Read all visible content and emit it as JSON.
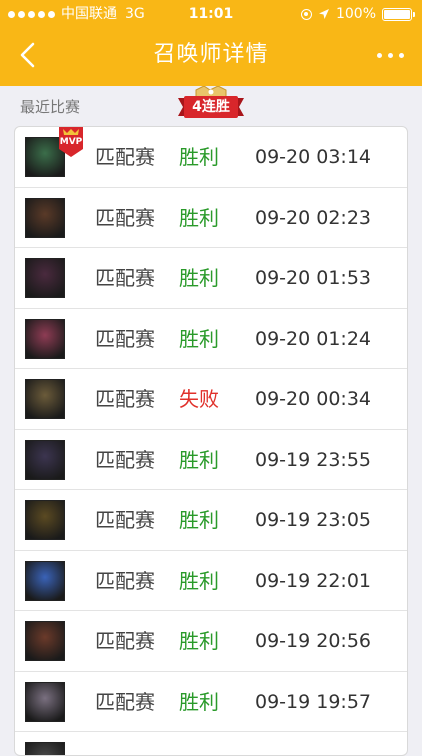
{
  "status_bar": {
    "carrier": "中国联通",
    "network": "3G",
    "time": "11:01",
    "battery": "100%"
  },
  "nav": {
    "title": "召唤师详情"
  },
  "section": {
    "label": "最近比赛",
    "streak_badge": "4连胜"
  },
  "mvp_badge": "MVP",
  "colors": {
    "brand": "#f9b716",
    "win": "#2a9a2a",
    "lose": "#e0302a",
    "ribbon": "#d8262b"
  },
  "matches": [
    {
      "mode": "匹配赛",
      "result": "胜利",
      "outcome": "win",
      "time": "09-20 03:14",
      "mvp": true,
      "avatar_color": "#3b6e4a"
    },
    {
      "mode": "匹配赛",
      "result": "胜利",
      "outcome": "win",
      "time": "09-20 02:23",
      "mvp": false,
      "avatar_color": "#5a3a28"
    },
    {
      "mode": "匹配赛",
      "result": "胜利",
      "outcome": "win",
      "time": "09-20 01:53",
      "mvp": false,
      "avatar_color": "#4a2a3e"
    },
    {
      "mode": "匹配赛",
      "result": "胜利",
      "outcome": "win",
      "time": "09-20 01:24",
      "mvp": false,
      "avatar_color": "#8e3c54"
    },
    {
      "mode": "匹配赛",
      "result": "失败",
      "outcome": "lose",
      "time": "09-20 00:34",
      "mvp": false,
      "avatar_color": "#6b5b3a"
    },
    {
      "mode": "匹配赛",
      "result": "胜利",
      "outcome": "win",
      "time": "09-19 23:55",
      "mvp": false,
      "avatar_color": "#3c3550"
    },
    {
      "mode": "匹配赛",
      "result": "胜利",
      "outcome": "win",
      "time": "09-19 23:05",
      "mvp": false,
      "avatar_color": "#5b4a22"
    },
    {
      "mode": "匹配赛",
      "result": "胜利",
      "outcome": "win",
      "time": "09-19 22:01",
      "mvp": false,
      "avatar_color": "#3a63b8"
    },
    {
      "mode": "匹配赛",
      "result": "胜利",
      "outcome": "win",
      "time": "09-19 20:56",
      "mvp": false,
      "avatar_color": "#6b3a2a"
    },
    {
      "mode": "匹配赛",
      "result": "胜利",
      "outcome": "win",
      "time": "09-19 19:57",
      "mvp": false,
      "avatar_color": "#7a7080"
    },
    {
      "mode": "",
      "result": "",
      "outcome": "win",
      "time": "",
      "mvp": false,
      "avatar_color": "#4a4a4a"
    }
  ]
}
